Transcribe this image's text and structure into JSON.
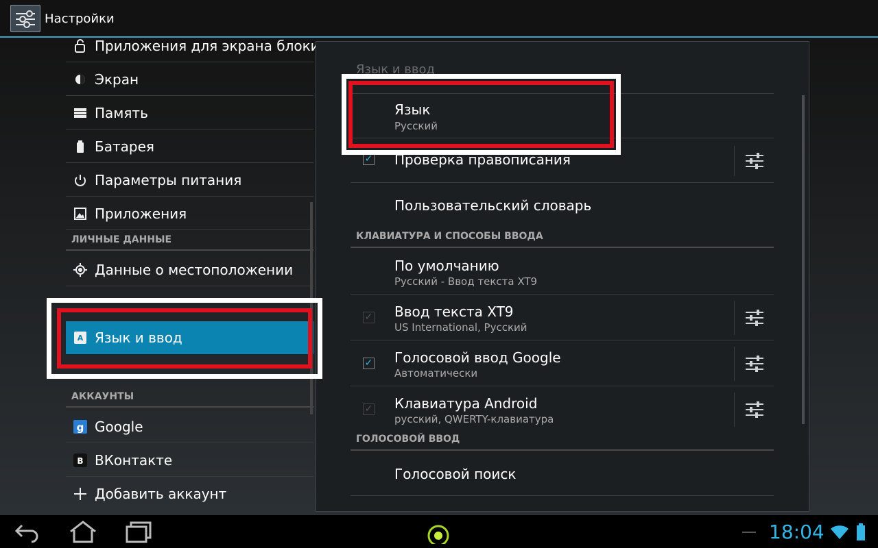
{
  "actionbar": {
    "title": "Настройки"
  },
  "left_menu": {
    "items": [
      {
        "label": "Приложения для экрана блоки",
        "icon": "lock-icon"
      },
      {
        "label": "Экран",
        "icon": "brightness-icon"
      },
      {
        "label": "Память",
        "icon": "storage-icon"
      },
      {
        "label": "Батарея",
        "icon": "battery-icon"
      },
      {
        "label": "Параметры питания",
        "icon": "power-icon"
      },
      {
        "label": "Приложения",
        "icon": "apps-icon"
      }
    ],
    "personal_header": "ЛИЧНЫЕ ДАННЫЕ",
    "personal_items": [
      {
        "label": "Данные о местоположении",
        "icon": "location-icon"
      },
      {
        "label": "Язык и ввод",
        "icon": "language-icon"
      }
    ],
    "accounts_header": "АККАУНТЫ",
    "accounts_items": [
      {
        "label": "Google",
        "icon": "google-icon"
      },
      {
        "label": "ВКонтакте",
        "icon": "vk-icon"
      },
      {
        "label": "Добавить аккаунт",
        "icon": "plus-icon"
      }
    ]
  },
  "panel": {
    "title": "Язык и ввод",
    "language": {
      "title": "Язык",
      "summary": "Русский"
    },
    "spellcheck": {
      "title": "Проверка правописания",
      "checked": true
    },
    "user_dictionary": {
      "title": "Пользовательский словарь"
    },
    "keyboard_header": "КЛАВИАТУРА И СПОСОБЫ ВВОДА",
    "default_ime": {
      "title": "По умолчанию",
      "summary": "Русский - Ввод текста XT9"
    },
    "xt9": {
      "title": "Ввод текста XT9",
      "summary": "US International, Русский",
      "checked": true
    },
    "google_voice": {
      "title": "Голосовой ввод Google",
      "summary": "Автоматически",
      "checked": true
    },
    "android_keyboard": {
      "title": "Клавиатура Android",
      "summary": "русский, QWERTY-клавиатура",
      "checked": true
    },
    "voice_header": "ГОЛОСОВОЙ ВВОД",
    "voice_search": {
      "title": "Голосовой поиск"
    }
  },
  "statusbar": {
    "time": "18:04"
  },
  "colors": {
    "accent": "#33b5e5",
    "selected": "#0b84b2",
    "highlight_red": "#e0121f"
  }
}
